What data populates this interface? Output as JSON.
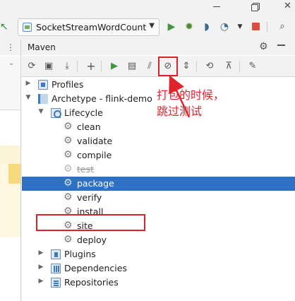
{
  "titlebar": {
    "minimize_icon": "minimize-icon",
    "maximize_icon": "restore-icon",
    "close_glyph": "✕"
  },
  "run_toolbar": {
    "config_name": "SocketStreamWordCount",
    "icons": [
      "run-icon",
      "debug-icon",
      "coverage-icon",
      "profiler-icon",
      "more-icon",
      "stop-icon",
      "search-icon"
    ]
  },
  "maven_panel": {
    "title": "Maven",
    "toolbar_icons": [
      "reload-icon",
      "generate-sources-icon",
      "download-icon",
      "add-icon",
      "run-icon",
      "execute-goal-icon",
      "toggle-offline-icon",
      "skip-tests-icon",
      "collapse-icon",
      "show-dependencies-icon",
      "collapse-all-icon",
      "settings-icon"
    ],
    "tree": {
      "profiles": "Profiles",
      "project": "Archetype - flink-demo",
      "lifecycle": "Lifecycle",
      "phases": [
        "clean",
        "validate",
        "compile",
        "test",
        "package",
        "verify",
        "install",
        "site",
        "deploy"
      ],
      "selected_phase": "package",
      "skipped_phase": "test",
      "plugins": "Plugins",
      "dependencies": "Dependencies",
      "repositories": "Repositories"
    }
  },
  "annotation": {
    "text": "打包的时候，\n跳过测试",
    "color": "#e0242b"
  },
  "colors": {
    "selection": "#2e70c4",
    "highlight_box": "#d8232a"
  }
}
